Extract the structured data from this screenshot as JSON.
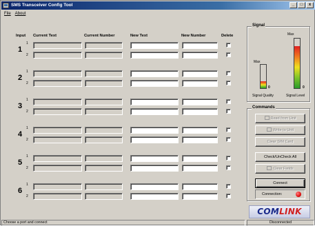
{
  "window": {
    "title": "SMS Transceiver Config Tool",
    "min_glyph": "_",
    "max_glyph": "□",
    "close_glyph": "x"
  },
  "menu": {
    "file": "File",
    "about": "About"
  },
  "table": {
    "headers": {
      "input": "Input",
      "current_text": "Current Text",
      "current_number": "Current Number",
      "new_text": "New Text",
      "new_number": "New Number",
      "delete": "Delete"
    },
    "rows": [
      {
        "input": "1",
        "sub": [
          "1",
          "2"
        ]
      },
      {
        "input": "2",
        "sub": [
          "1",
          "2"
        ]
      },
      {
        "input": "3",
        "sub": [
          "1",
          "2"
        ]
      },
      {
        "input": "4",
        "sub": [
          "1",
          "2"
        ]
      },
      {
        "input": "5",
        "sub": [
          "1",
          "2"
        ]
      },
      {
        "input": "6",
        "sub": [
          "1",
          "2"
        ]
      }
    ]
  },
  "signal": {
    "group_label": "Signal",
    "quality": {
      "max_label": "Max",
      "zero_label": "0",
      "label": "Signal Quality",
      "level_fraction": 0.3
    },
    "level": {
      "max_label": "Max",
      "zero_label": "0",
      "label": "Signal Level",
      "level_fraction": 0.85
    }
  },
  "commands": {
    "group_label": "Commands",
    "read_from_unit": "Read from Unit",
    "write_to_unit": "Write to Unit",
    "clear_sim_card": "Clear SIM Card",
    "check_uncheck_all": "Check/UnCheck All",
    "clear_fields": "Clear Fields",
    "connect": "Connect",
    "connection_label": "Connection:",
    "connection_color": "#e01010"
  },
  "logo": {
    "com": "COM",
    "link": "LINK"
  },
  "statusbar": {
    "message": "Choose a port and connect",
    "state": "Disconnected"
  }
}
